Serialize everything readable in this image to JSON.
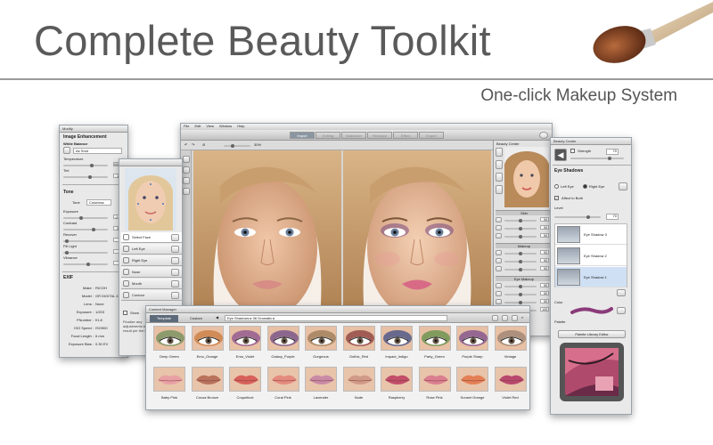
{
  "hero": {
    "title": "Complete Beauty Toolkit",
    "subtitle": "One-click Makeup System"
  },
  "left_panel": {
    "title": "Modify",
    "section_image": "Image Enhancement",
    "white_balance": "White Balance",
    "wb_value": "As Shot",
    "temperature": "Temperature",
    "temperature_val": "6500",
    "tint": "Tint",
    "tint_val": "10",
    "tone": "Tone",
    "tone_label": "Tone",
    "tone_value": "Colorless",
    "exposure": "Exposure",
    "exposure_val": "-1.0",
    "contrast": "Contrast",
    "contrast_val": "30",
    "recover": "Recover",
    "recover_val": "0",
    "fill_light": "Fill Light",
    "fill_light_val": "0",
    "vibrance": "Vibrance",
    "vibrance_val": "5",
    "exif": "EXIF",
    "exif_rows": [
      {
        "k": "Make :",
        "v": "RICOH"
      },
      {
        "k": "Model :",
        "v": "GR DIGITAL 4"
      },
      {
        "k": "Lens :",
        "v": "None"
      },
      {
        "k": "Exposure :",
        "v": "1/203"
      },
      {
        "k": "FNumber :",
        "v": "f/1.8"
      },
      {
        "k": "ISO Speed :",
        "v": "ISO900"
      },
      {
        "k": "Focal Length :",
        "v": "6 mm"
      },
      {
        "k": "Exposure Bias :",
        "v": "0.30 EV"
      }
    ]
  },
  "face_panel": {
    "items": [
      "Select Face",
      "Left Eye",
      "Right Eye",
      "Nose",
      "Mouth",
      "Contour"
    ],
    "show_label": "Show",
    "hint": "Finalize any adjustments to the result per the in"
  },
  "main_window": {
    "menu": [
      "File",
      "Edit",
      "View",
      "Window",
      "Help"
    ],
    "tabs": [
      "Import",
      "Editing",
      "Makeover",
      "Reshape",
      "Effect",
      "Export"
    ],
    "zoom": "30%"
  },
  "beauty_side": {
    "title": "Beauty Center",
    "groups": [
      "Skin",
      "Makeup",
      "Eye Makeup"
    ],
    "vals": [
      "50",
      "50",
      "50",
      "50",
      "50",
      "50",
      "50",
      "50",
      "50",
      "100"
    ]
  },
  "content_manager": {
    "title": "Content Manager",
    "tabs": [
      "Template",
      "Custom"
    ],
    "breadcrumb": "Eye Shadows ▸ 06 Dramatic ▸",
    "eye_labels": [
      "Deep Green",
      "Emo_Orange",
      "Emo_Violet",
      "Galaxy_Purple",
      "Gorgeous",
      "Gothic_Red",
      "Impact_Indigo",
      "Party_Green",
      "Purple Sharp",
      "Vintage"
    ],
    "lip_labels": [
      "Baby Pink",
      "Cocoa Bronze",
      "Coquelicot",
      "Coral Pink",
      "Lavender",
      "Nude",
      "Raspberry",
      "Rose Pink",
      "Sunset Orange",
      "Violet Red"
    ]
  },
  "right_panel": {
    "title": "Beauty Center",
    "strength_label": "Strength",
    "strength_val": "70",
    "section": "Eye Shadows",
    "left_eye": "Left Eye",
    "right_eye": "Right Eye",
    "affect_both": "Affect to Both",
    "level": "Level",
    "level_val": "70",
    "shadows": [
      "Eye Shadow 3",
      "Eye Shadow 2",
      "Eye Shadow 1"
    ],
    "color": "Color",
    "palette": "Palette",
    "palette_btn": "Palette Library Editor"
  },
  "colors": {
    "eye_tints": [
      "#6f8e5a",
      "#c87a3e",
      "#8b4f8f",
      "#6d4a86",
      "#9a7a55",
      "#8a3b3b",
      "#3e4c86",
      "#5f8f47",
      "#7a4b8c",
      "#9a8070"
    ],
    "lip_tints": [
      "#e8a0a4",
      "#b9735c",
      "#d8605a",
      "#e58a7e",
      "#c98aa6",
      "#d19a88",
      "#c24e6a",
      "#db7f90",
      "#e48055",
      "#b8486e"
    ],
    "accent_blue": "#4a7ab8"
  }
}
